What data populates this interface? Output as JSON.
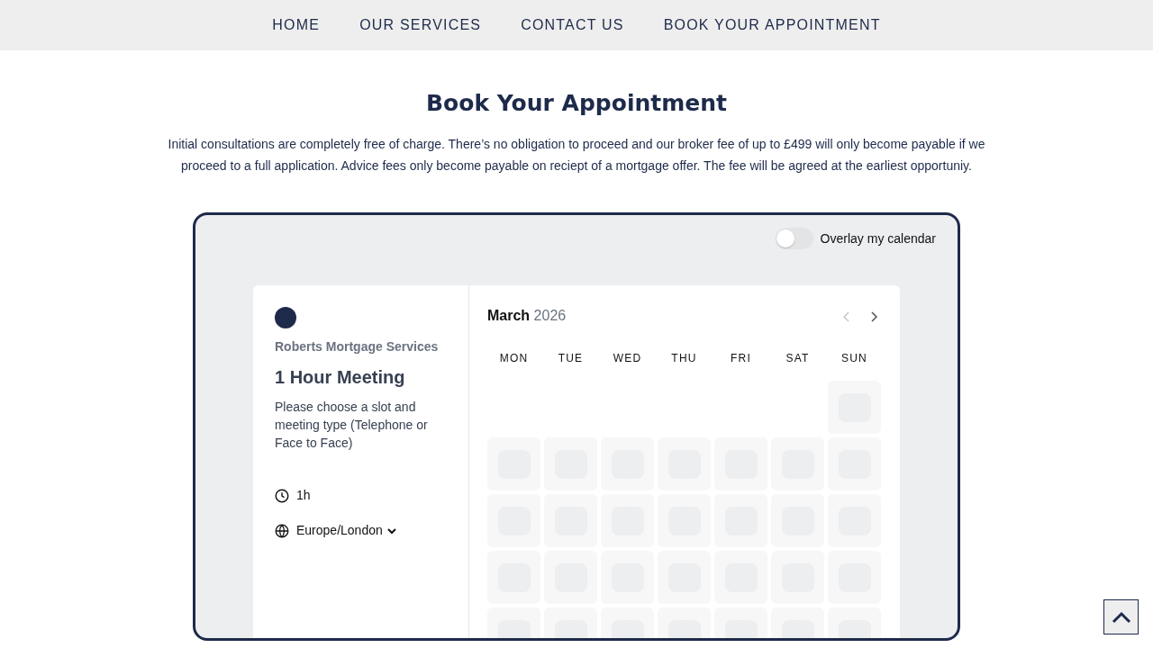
{
  "nav": {
    "items": [
      {
        "label": "HOME",
        "selected": false
      },
      {
        "label": "OUR SERVICES",
        "selected": false
      },
      {
        "label": "CONTACT US",
        "selected": false
      },
      {
        "label": "BOOK YOUR APPOINTMENT",
        "selected": false
      }
    ]
  },
  "heading": "Book Your Appointment",
  "intro": "Initial consultations are completely free of charge. There’s no obligation to proceed and our broker fee of up to £499 will only become payable if we proceed to a full application. Advice fees only become payable on reciept of a mortgage offer. The fee will be agreed at the earliest opportuniy.",
  "booking": {
    "overlay_toggle": {
      "label": "Overlay my calendar",
      "on": false
    },
    "company": "Roberts Mortgage Services",
    "event_title": "1 Hour Meeting",
    "description": "Please choose a slot and meeting type (Telephone or Face to Face)",
    "duration": "1h",
    "timezone": "Europe/London",
    "calendar": {
      "month": "March",
      "year": "2026",
      "weekdays": [
        "MON",
        "TUE",
        "WED",
        "THU",
        "FRI",
        "SAT",
        "SUN"
      ],
      "weeks": [
        [
          {
            "kind": "blank"
          },
          {
            "kind": "blank"
          },
          {
            "kind": "blank"
          },
          {
            "kind": "blank"
          },
          {
            "kind": "blank"
          },
          {
            "kind": "blank"
          },
          {
            "kind": "loading"
          }
        ],
        [
          {
            "kind": "loading"
          },
          {
            "kind": "loading"
          },
          {
            "kind": "loading"
          },
          {
            "kind": "loading"
          },
          {
            "kind": "loading"
          },
          {
            "kind": "loading"
          },
          {
            "kind": "loading"
          }
        ],
        [
          {
            "kind": "loading"
          },
          {
            "kind": "loading"
          },
          {
            "kind": "loading"
          },
          {
            "kind": "loading"
          },
          {
            "kind": "loading"
          },
          {
            "kind": "loading"
          },
          {
            "kind": "loading"
          }
        ],
        [
          {
            "kind": "loading"
          },
          {
            "kind": "loading"
          },
          {
            "kind": "loading"
          },
          {
            "kind": "loading"
          },
          {
            "kind": "loading"
          },
          {
            "kind": "loading"
          },
          {
            "kind": "loading"
          }
        ],
        [
          {
            "kind": "loading"
          },
          {
            "kind": "loading"
          },
          {
            "kind": "loading"
          },
          {
            "kind": "loading"
          },
          {
            "kind": "loading"
          },
          {
            "kind": "loading"
          },
          {
            "kind": "loading"
          }
        ]
      ]
    }
  }
}
